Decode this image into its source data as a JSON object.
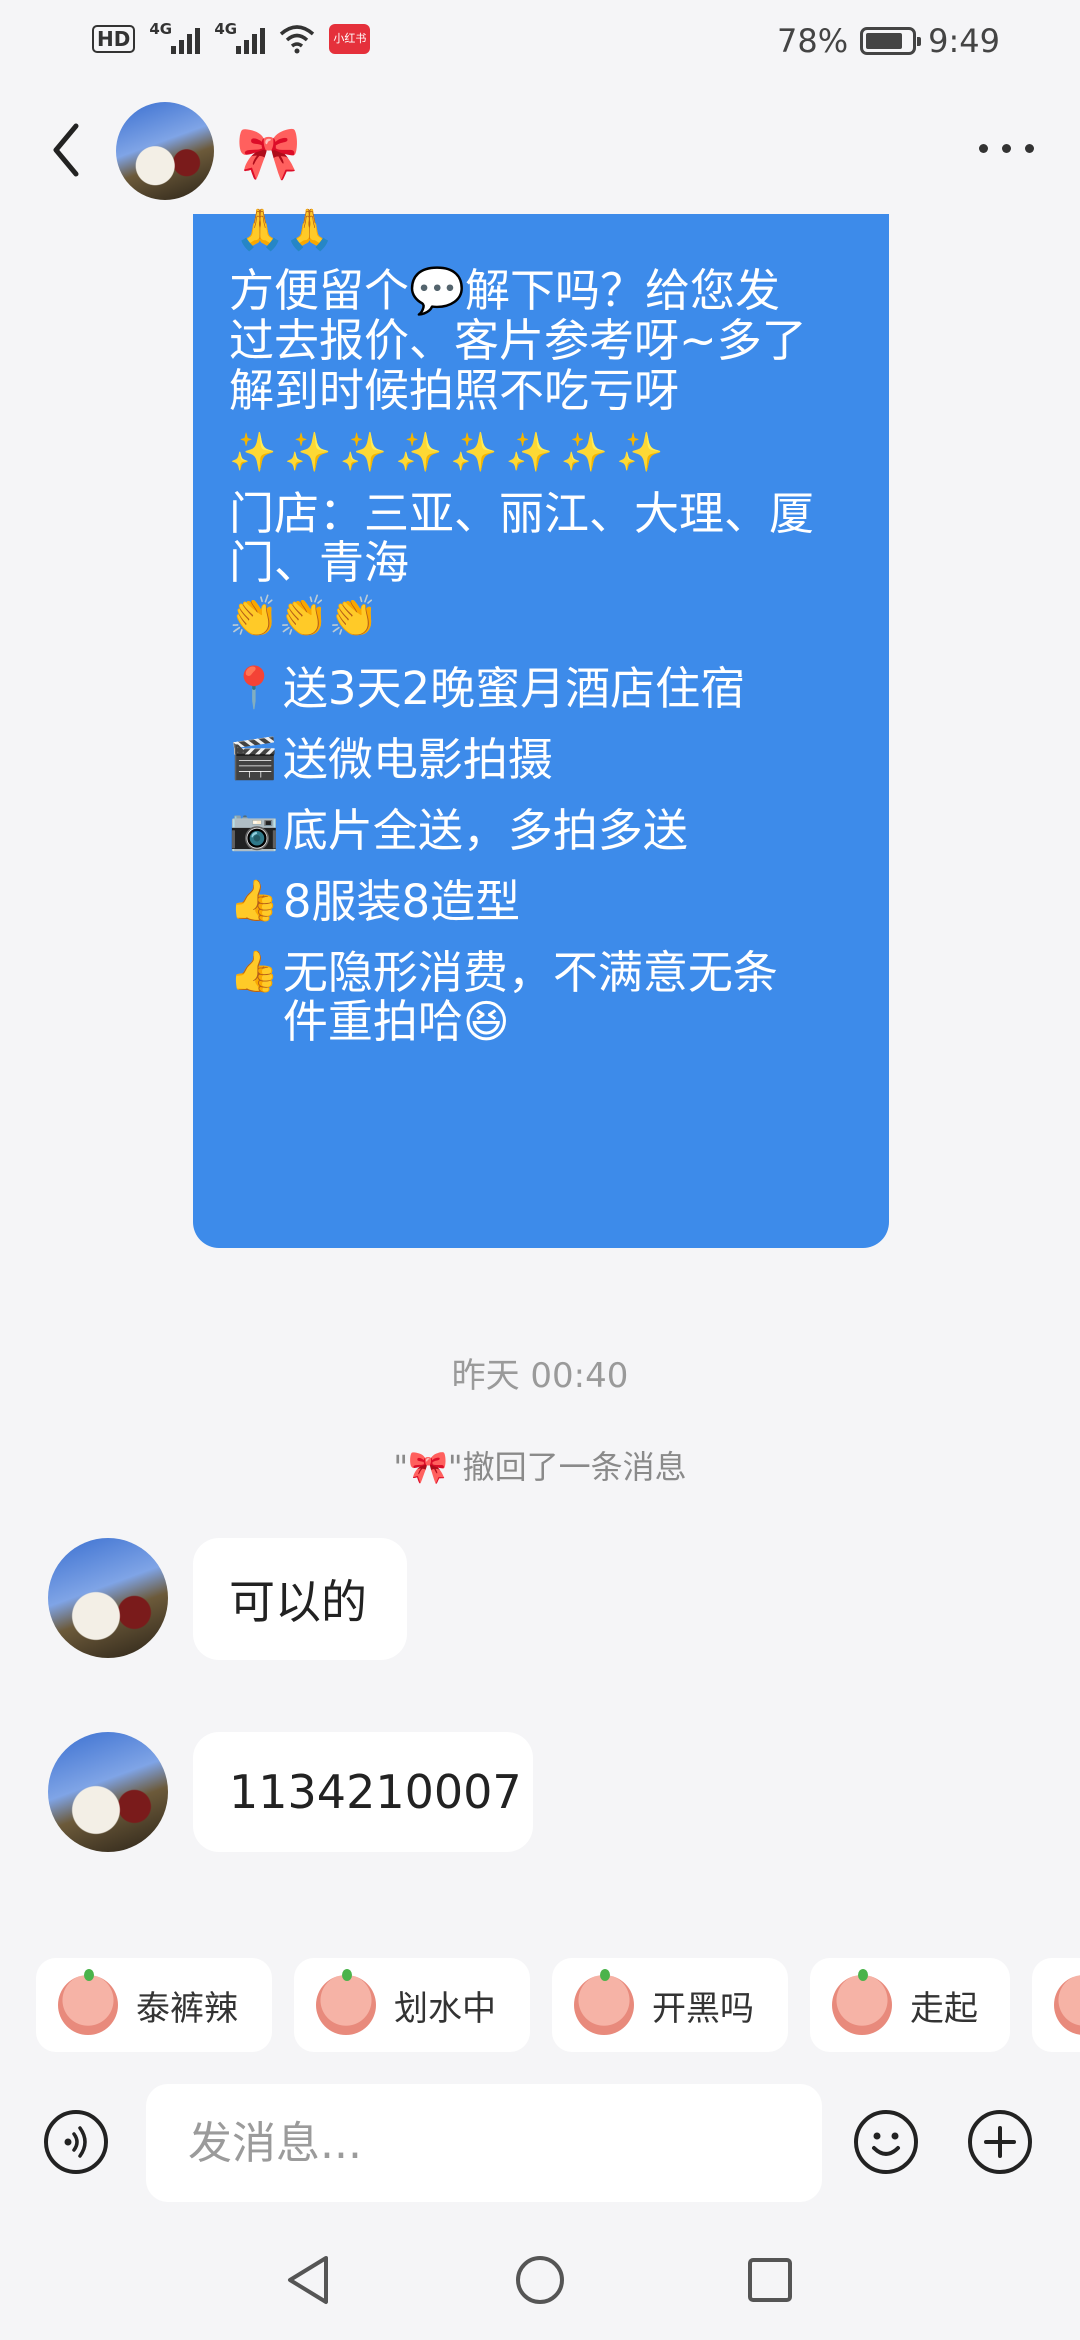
{
  "status_bar": {
    "hd": "HD",
    "signal1": "4G",
    "signal2": "4G",
    "app_badge": "小红书",
    "battery": "78%",
    "time": "9:49"
  },
  "header": {
    "name": "🎀"
  },
  "outgoing": {
    "top_emoji": "🙏🙏",
    "paragraph1": "方便留个💬解下吗？给您发\n过去报价、客片参考呀~多了\n解到时候拍照不吃亏呀",
    "sparkles": "✨✨✨✨✨✨✨✨",
    "stores": "门店：三亚、丽江、大理、厦\n门、青海",
    "claps": "👏👏👏",
    "line1_emoji": "📍",
    "line1": "送3天2晚蜜月酒店住宿",
    "line2_emoji": "🎬",
    "line2": "送微电影拍摄",
    "line3_emoji": "📷",
    "line3": "底片全送，多拍多送",
    "line4_emoji": "👍",
    "line4": "8服装8造型",
    "line5_emoji": "👍",
    "line5": "无隐形消费，不满意无条\n件重拍哈😆"
  },
  "timestamp": "昨天 00:40",
  "recall": "\"🎀\"撤回了一条消息",
  "incoming": [
    {
      "text": "可以的"
    },
    {
      "text": "1134210007"
    }
  ],
  "quick_replies": [
    {
      "label": "泰裤辣"
    },
    {
      "label": "划水中"
    },
    {
      "label": "开黑吗"
    },
    {
      "label": "走起"
    }
  ],
  "input": {
    "placeholder": "发消息..."
  }
}
